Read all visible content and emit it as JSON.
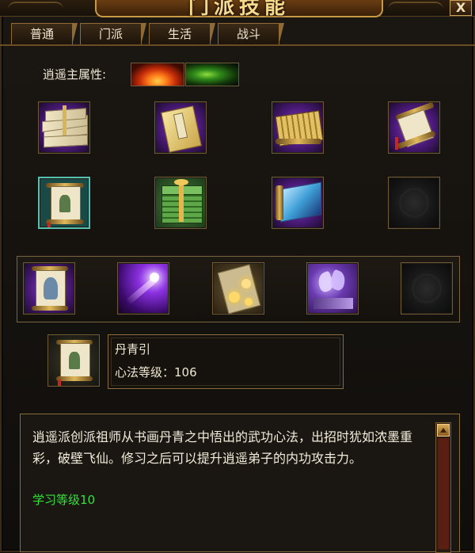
{
  "window": {
    "title": "门派技能",
    "close_label": "X"
  },
  "tabs": [
    {
      "label": "普通"
    },
    {
      "label": "门派"
    },
    {
      "label": "生活"
    },
    {
      "label": "战斗"
    }
  ],
  "attribute": {
    "label": "逍遥主属性:",
    "types": [
      {
        "name": "fire-icon"
      },
      {
        "name": "poison-icon"
      }
    ]
  },
  "skill_grid": {
    "row1": [
      "bundle-of-books-icon",
      "yellow-book-icon",
      "golden-scroll-icon",
      "open-scroll-icon"
    ],
    "row2": [
      "painted-scroll-icon",
      "green-book-stack-icon",
      "water-scroll-icon",
      "empty-slot-icon"
    ]
  },
  "skill_band": [
    "portrait-scroll-icon",
    "purple-comet-icon",
    "golden-orbs-icon",
    "butterfly-icon",
    "empty-slot-icon"
  ],
  "selected_skill": {
    "icon": "painted-scroll-icon",
    "name": "丹青引",
    "level_text": "心法等级：106"
  },
  "description": {
    "text": "逍遥派创派祖师从书画丹青之中悟出的武功心法，出招时犹如浓墨重彩，破壁飞仙。修习之后可以提升逍遥弟子的内功攻击力。",
    "learn_level": "学习等级10"
  },
  "colors": {
    "accent_gold": "#c99a45",
    "learn_green": "#35e03a",
    "text": "#f3ecdc"
  }
}
